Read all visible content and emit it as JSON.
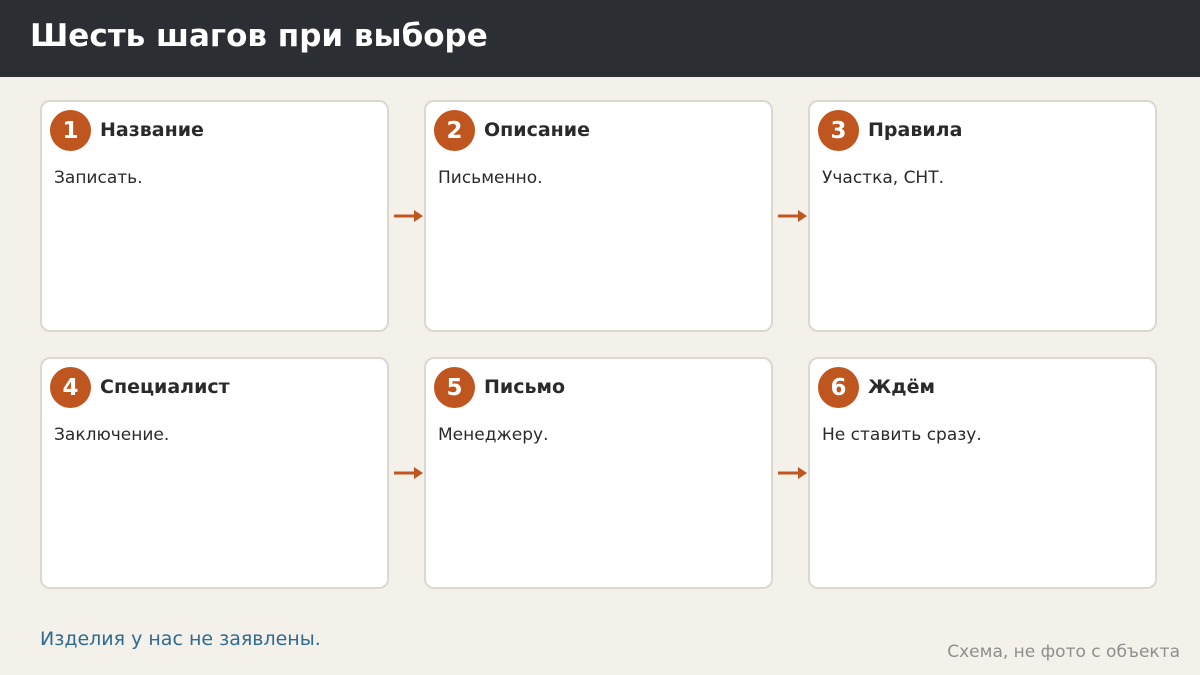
{
  "header": {
    "title": "Шесть шагов при выборе"
  },
  "steps": [
    {
      "number": "1",
      "title": "Название",
      "text": "Записать."
    },
    {
      "number": "2",
      "title": "Описание",
      "text": "Письменно."
    },
    {
      "number": "3",
      "title": "Правила",
      "text": "Участка, СНТ."
    },
    {
      "number": "4",
      "title": "Специалист",
      "text": "Заключение."
    },
    {
      "number": "5",
      "title": "Письмо",
      "text": "Менеджеру."
    },
    {
      "number": "6",
      "title": "Ждём",
      "text": "Не ставить сразу."
    }
  ],
  "footer": {
    "note": "Изделия у нас не заявлены.",
    "caption": "Схема, не фото с объекта"
  },
  "colors": {
    "accent": "#c0561f",
    "header_bg": "#2b2e33",
    "page_bg": "#f4f1eb",
    "note_text": "#2f6a8f"
  }
}
